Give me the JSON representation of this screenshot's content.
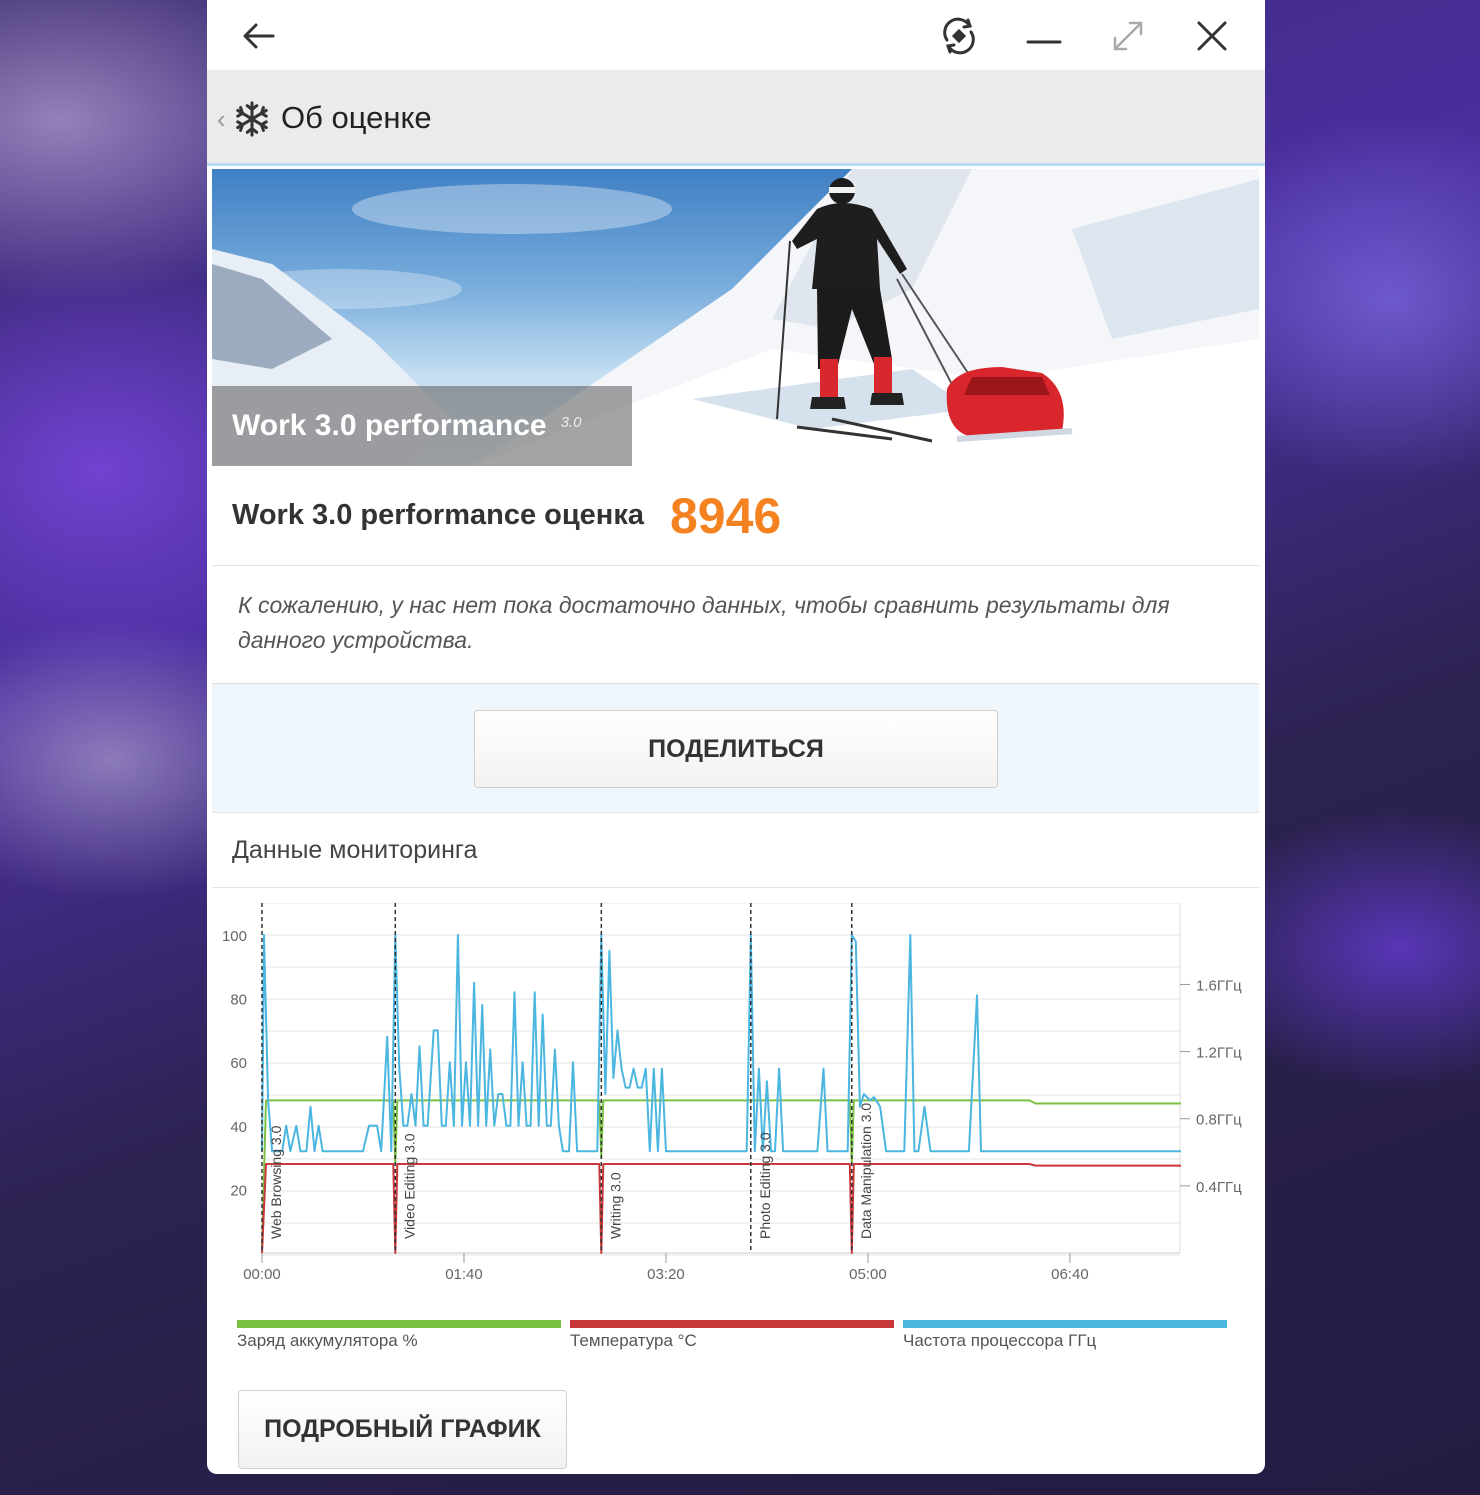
{
  "window": {
    "title": "Об оценке",
    "icons": [
      "back-arrow-icon",
      "rotate-icon",
      "minimize-icon",
      "maximize-icon",
      "close-icon",
      "snowflake-icon"
    ]
  },
  "hero": {
    "title": "Work 3.0 performance",
    "version": "3.0"
  },
  "score": {
    "label": "Work 3.0 performance оценка",
    "value": "8946",
    "value_color": "#f58220"
  },
  "compare_note": "К сожалению, у нас нет пока достаточно данных, чтобы сравнить результаты для данного устройства.",
  "share_button": "ПОДЕЛИТЬСЯ",
  "monitoring": {
    "title": "Данные мониторинга",
    "detail_button": "ПОДРОБНЫЙ ГРАФИК"
  },
  "legend": [
    {
      "label": "Заряд аккумулятора %",
      "color": "#7bc143"
    },
    {
      "label": "Температура °C",
      "color": "#c8383b"
    },
    {
      "label": "Частота процессора ГГц",
      "color": "#4bb6e0"
    }
  ],
  "chart_data": {
    "type": "line",
    "x_unit": "seconds",
    "x_ticks": [
      "00:00",
      "01:40",
      "03:20",
      "05:00",
      "06:40"
    ],
    "x_tick_values": [
      0,
      100,
      200,
      300,
      400
    ],
    "xlim": [
      0,
      455
    ],
    "left_ticks": [
      "100",
      "80",
      "60",
      "40",
      "20"
    ],
    "left_tick_values": [
      100,
      80,
      60,
      40,
      20
    ],
    "ylim_left": [
      0,
      110
    ],
    "right_ticks": [
      "1.6ГГц",
      "1.2ГГц",
      "0.8ГГц",
      "0.4ГГц"
    ],
    "right_tick_values": [
      1.6,
      1.2,
      0.8,
      0.4
    ],
    "markers": [
      {
        "label": "Web Browsing 3.0",
        "x": 0
      },
      {
        "label": "Video Editing 3.0",
        "x": 66
      },
      {
        "label": "Writing 3.0",
        "x": 168
      },
      {
        "label": "Photo Editing 3.0",
        "x": 242
      },
      {
        "label": "Data Manipulation 3.0",
        "x": 292
      }
    ],
    "series": [
      {
        "name": "Заряд аккумулятора %",
        "color": "#7bc143",
        "points": [
          [
            0,
            2
          ],
          [
            2,
            48
          ],
          [
            65,
            48
          ],
          [
            66,
            28
          ],
          [
            67,
            48
          ],
          [
            167,
            48
          ],
          [
            168,
            30
          ],
          [
            169,
            48
          ],
          [
            291,
            48
          ],
          [
            292,
            28
          ],
          [
            293,
            48
          ],
          [
            380,
            48
          ],
          [
            383,
            47
          ],
          [
            455,
            47
          ]
        ]
      },
      {
        "name": "Температура °C",
        "color": "#c8383b",
        "points": [
          [
            0,
            0
          ],
          [
            2,
            28
          ],
          [
            65,
            28
          ],
          [
            66,
            0
          ],
          [
            67,
            28
          ],
          [
            167,
            28
          ],
          [
            168,
            0
          ],
          [
            169,
            28
          ],
          [
            291,
            28
          ],
          [
            292,
            0
          ],
          [
            293,
            28
          ],
          [
            380,
            28
          ],
          [
            383,
            27.5
          ],
          [
            455,
            27.5
          ]
        ]
      },
      {
        "name": "Частота процессора ГГц",
        "color": "#4bb6e0",
        "points": [
          [
            0,
            32
          ],
          [
            1,
            100
          ],
          [
            3,
            48
          ],
          [
            5,
            32
          ],
          [
            10,
            32
          ],
          [
            12,
            40
          ],
          [
            14,
            32
          ],
          [
            17,
            40
          ],
          [
            19,
            32
          ],
          [
            22,
            32
          ],
          [
            24,
            46
          ],
          [
            26,
            32
          ],
          [
            28,
            40
          ],
          [
            30,
            32
          ],
          [
            35,
            32
          ],
          [
            38,
            32
          ],
          [
            50,
            32
          ],
          [
            53,
            40
          ],
          [
            57,
            40
          ],
          [
            59,
            32
          ],
          [
            62,
            68
          ],
          [
            64,
            32
          ],
          [
            66,
            100
          ],
          [
            68,
            58
          ],
          [
            70,
            40
          ],
          [
            72,
            40
          ],
          [
            74,
            50
          ],
          [
            76,
            40
          ],
          [
            78,
            65
          ],
          [
            80,
            40
          ],
          [
            82,
            40
          ],
          [
            85,
            70
          ],
          [
            87,
            70
          ],
          [
            89,
            40
          ],
          [
            91,
            40
          ],
          [
            93,
            60
          ],
          [
            95,
            40
          ],
          [
            97,
            100
          ],
          [
            99,
            40
          ],
          [
            101,
            60
          ],
          [
            103,
            40
          ],
          [
            105,
            85
          ],
          [
            107,
            40
          ],
          [
            109,
            78
          ],
          [
            111,
            40
          ],
          [
            113,
            64
          ],
          [
            115,
            40
          ],
          [
            117,
            50
          ],
          [
            119,
            50
          ],
          [
            121,
            40
          ],
          [
            123,
            40
          ],
          [
            125,
            82
          ],
          [
            127,
            40
          ],
          [
            129,
            60
          ],
          [
            131,
            40
          ],
          [
            133,
            40
          ],
          [
            135,
            82
          ],
          [
            137,
            40
          ],
          [
            139,
            75
          ],
          [
            141,
            40
          ],
          [
            143,
            40
          ],
          [
            145,
            64
          ],
          [
            147,
            40
          ],
          [
            149,
            32
          ],
          [
            152,
            32
          ],
          [
            154,
            60
          ],
          [
            156,
            32
          ],
          [
            160,
            32
          ],
          [
            163,
            32
          ],
          [
            166,
            32
          ],
          [
            168,
            100
          ],
          [
            170,
            50
          ],
          [
            172,
            95
          ],
          [
            174,
            55
          ],
          [
            176,
            70
          ],
          [
            178,
            58
          ],
          [
            180,
            52
          ],
          [
            182,
            52
          ],
          [
            184,
            58
          ],
          [
            186,
            52
          ],
          [
            188,
            52
          ],
          [
            190,
            58
          ],
          [
            192,
            32
          ],
          [
            194,
            58
          ],
          [
            196,
            32
          ],
          [
            198,
            58
          ],
          [
            200,
            32
          ],
          [
            202,
            32
          ],
          [
            212,
            32
          ],
          [
            215,
            32
          ],
          [
            240,
            32
          ],
          [
            242,
            100
          ],
          [
            244,
            32
          ],
          [
            246,
            58
          ],
          [
            248,
            32
          ],
          [
            250,
            54
          ],
          [
            252,
            32
          ],
          [
            254,
            32
          ],
          [
            256,
            58
          ],
          [
            258,
            32
          ],
          [
            260,
            32
          ],
          [
            265,
            32
          ],
          [
            268,
            32
          ],
          [
            275,
            32
          ],
          [
            278,
            58
          ],
          [
            280,
            32
          ],
          [
            285,
            32
          ],
          [
            290,
            32
          ],
          [
            292,
            100
          ],
          [
            294,
            98
          ],
          [
            296,
            46
          ],
          [
            298,
            50
          ],
          [
            301,
            48
          ],
          [
            303,
            49
          ],
          [
            306,
            46
          ],
          [
            309,
            32
          ],
          [
            312,
            32
          ],
          [
            314,
            32
          ],
          [
            318,
            32
          ],
          [
            321,
            100
          ],
          [
            323,
            32
          ],
          [
            325,
            32
          ],
          [
            328,
            46
          ],
          [
            331,
            32
          ],
          [
            340,
            32
          ],
          [
            350,
            32
          ],
          [
            354,
            81
          ],
          [
            356,
            32
          ],
          [
            380,
            32
          ],
          [
            400,
            32
          ],
          [
            455,
            32
          ]
        ]
      }
    ]
  }
}
